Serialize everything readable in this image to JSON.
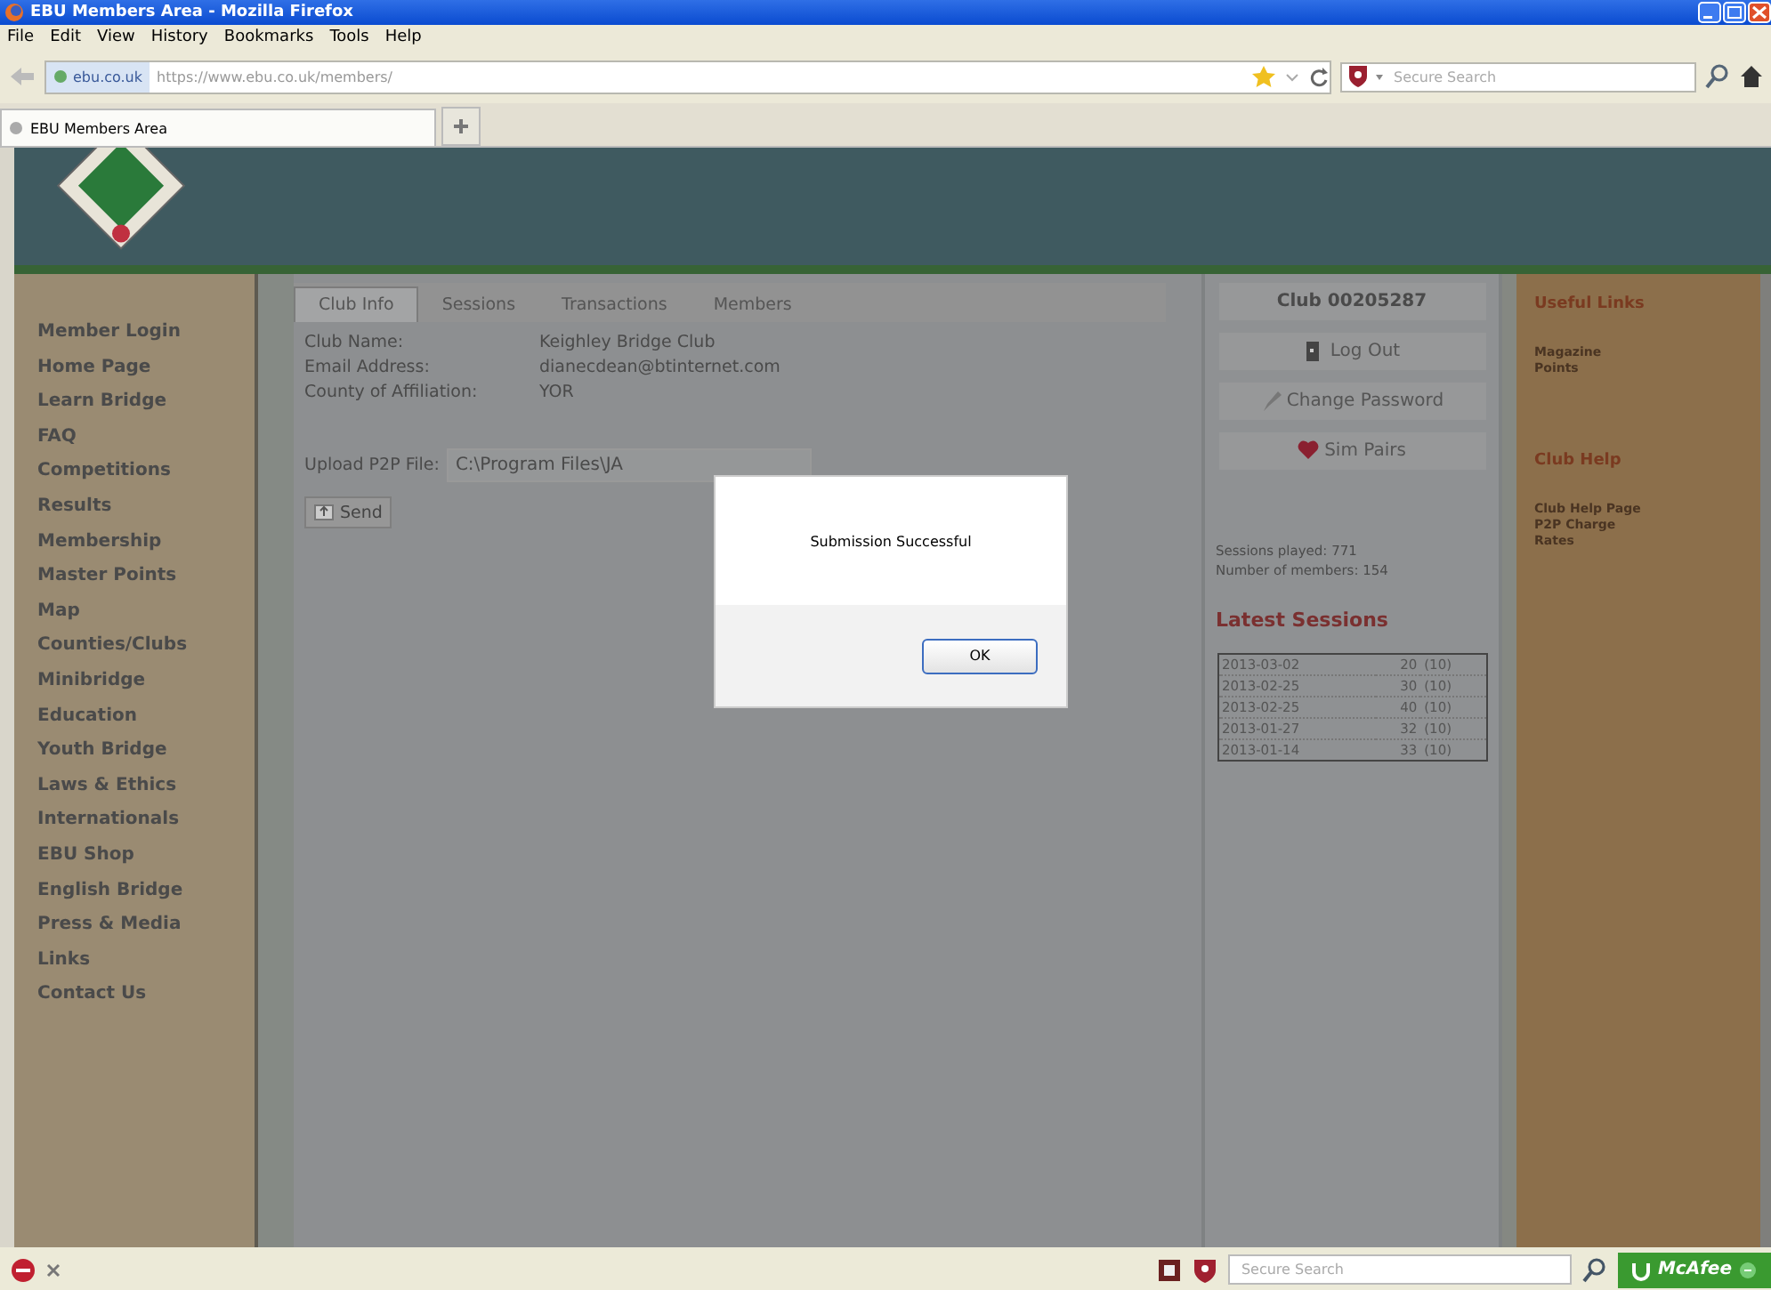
{
  "window": {
    "title": "EBU Members Area - Mozilla Firefox"
  },
  "menu": [
    "File",
    "Edit",
    "View",
    "History",
    "Bookmarks",
    "Tools",
    "Help"
  ],
  "address_bar": {
    "site": "ebu.co.uk",
    "url": "https://www.ebu.co.uk/members/"
  },
  "search_box": {
    "placeholder": "Secure Search"
  },
  "browser_tabs": [
    {
      "label": "EBU Members Area",
      "selected": true
    }
  ],
  "sidebar": {
    "items": [
      "Member Login",
      "Home Page",
      "Learn Bridge",
      "FAQ",
      "Competitions",
      "Results",
      "Membership",
      "Master Points",
      "Map",
      "Counties/Clubs",
      "Minibridge",
      "Education",
      "Youth Bridge",
      "Laws & Ethics",
      "Internationals",
      "EBU Shop",
      "English Bridge",
      "Press & Media",
      "Links",
      "Contact Us"
    ]
  },
  "tabs": [
    {
      "label": "Club Info",
      "selected": true
    },
    {
      "label": "Sessions",
      "selected": false
    },
    {
      "label": "Transactions",
      "selected": false
    },
    {
      "label": "Members",
      "selected": false
    }
  ],
  "club_info": [
    {
      "label": "Club Name:",
      "value": "Keighley Bridge Club"
    },
    {
      "label": "Email Address:",
      "value": "dianecdean@btinternet.com"
    },
    {
      "label": "County of Affiliation:",
      "value": "YOR"
    }
  ],
  "upload": {
    "label": "Upload P2P File:",
    "value": "C:\\Program Files\\JA",
    "button": "Send"
  },
  "club_panel": {
    "title": "Club 00205287",
    "buttons": [
      {
        "kind": "logout",
        "label": "Log Out"
      },
      {
        "kind": "password",
        "label": "Change Password"
      },
      {
        "kind": "simpairs",
        "label": "Sim Pairs"
      }
    ],
    "stats": [
      "Sessions played: 771",
      "Number of members: 154"
    ],
    "sessions_title": "Latest Sessions",
    "sessions": [
      [
        "2013-03-02",
        "20",
        "(10)"
      ],
      [
        "2013-02-25",
        "30",
        "(10)"
      ],
      [
        "2013-02-25",
        "40",
        "(10)"
      ],
      [
        "2013-01-27",
        "32",
        "(10)"
      ],
      [
        "2013-01-14",
        "33",
        "(10)"
      ]
    ]
  },
  "links_panel": [
    {
      "title": "Useful Links",
      "links": [
        "Magazine Points"
      ]
    },
    {
      "title": "Club Help",
      "links": [
        "Club Help Page",
        "P2P Charge Rates"
      ]
    }
  ],
  "dialog": {
    "message": "Submission Successful",
    "button": "OK"
  },
  "status_bar": {
    "search_placeholder": "Secure Search",
    "mcafee": "McAfee"
  }
}
